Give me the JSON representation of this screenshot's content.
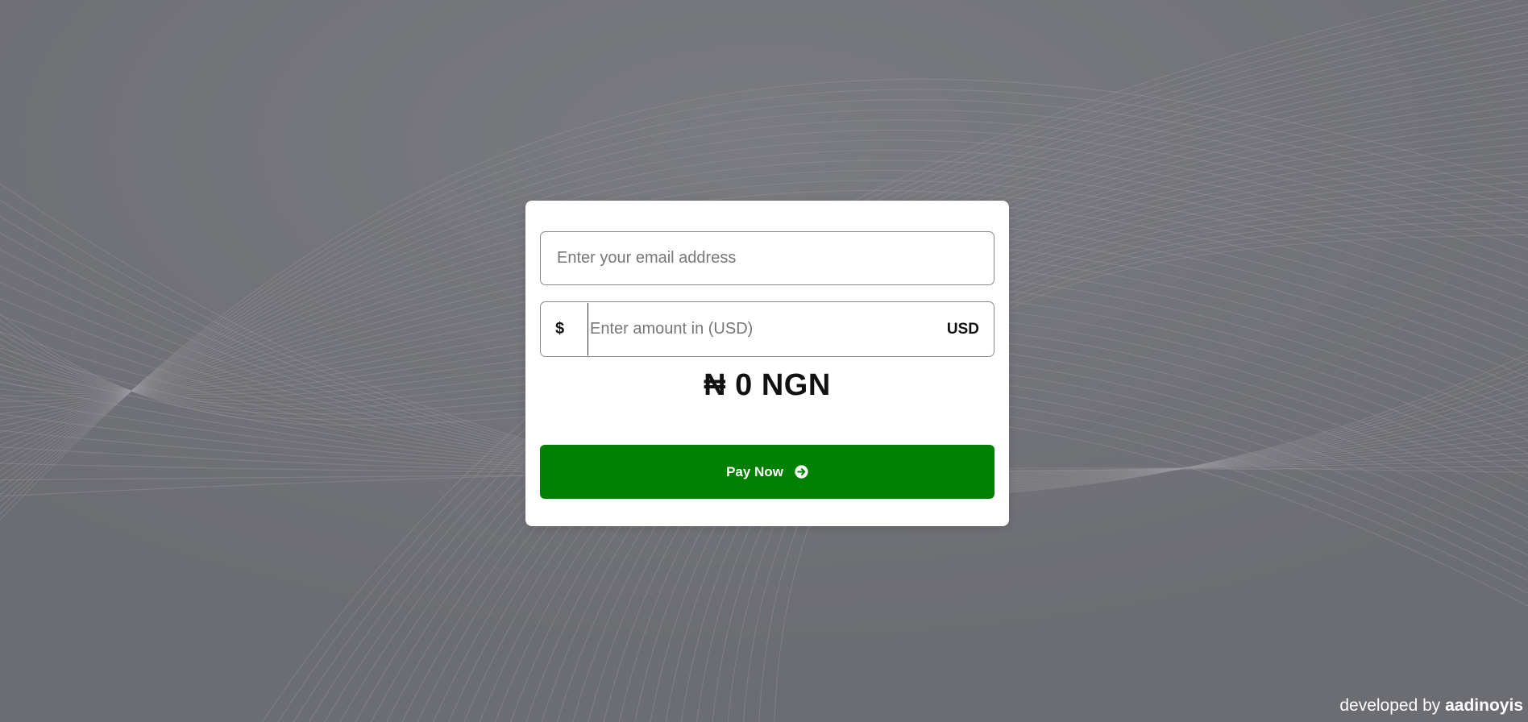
{
  "form": {
    "email_placeholder": "Enter your email address",
    "email_value": "",
    "amount_prefix": "$",
    "amount_placeholder": "Enter amount in (USD)",
    "amount_value": "",
    "amount_currency": "USD",
    "converted_amount": "₦ 0 NGN",
    "pay_button_label": "Pay Now"
  },
  "footer": {
    "prefix": "developed by",
    "author": "aadinoyis"
  },
  "colors": {
    "background": "#6f7075",
    "button": "#008000",
    "card": "#ffffff"
  },
  "icons": {
    "pay_button_icon": "arrow-circle-right-icon"
  }
}
